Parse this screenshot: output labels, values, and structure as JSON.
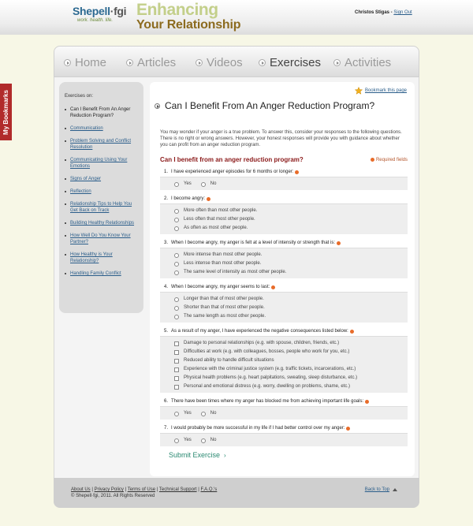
{
  "header": {
    "brand_a": "Shepell",
    "brand_b": "·fgi",
    "tagline": "work. health. life.",
    "program_line1": "Enhancing",
    "program_line2": "Your Relationship",
    "user": "Christos Stigas",
    "signout": "Sign Out",
    "separator": " - "
  },
  "bookmarks_tab": "My Bookmarks",
  "nav": {
    "tabs": [
      "Home",
      "Articles",
      "Videos",
      "Exercises",
      "Activities"
    ],
    "active": "Exercises"
  },
  "sidebar": {
    "heading": "Exercises on:",
    "items": [
      "Can I Benefit From An Anger Reduction Program?",
      "Communication",
      "Problem Solving and Conflict Resolution",
      "Communicating Using Your Emotions",
      "Signs of Anger",
      "Reflection",
      "Relationship Tips to Help You Get Back on Track",
      "Building Healthy Relationships",
      "How Well Do You Know Your Partner?",
      "How Healthy is Your Relationship?",
      "Handling Family Conflict"
    ]
  },
  "content": {
    "bookmark": "Bookmark this page",
    "title": "Can I Benefit From An Anger Reduction Program?",
    "intro": "You may wonder if your anger is a true problem. To answer this, consider your responses to the following questions. There is no right or wrong answers. However, your honest responses will provide you with guidance about whether you can profit from an anger reduction program.",
    "form_title": "Can I benefit from an anger reduction program?",
    "required": "Required fields",
    "submit": "Submit Exercise",
    "questions": [
      {
        "n": "1.",
        "text": "I have experienced anger episodes for 6 months or longer:",
        "type": "yn",
        "options": [
          "Yes",
          "No"
        ]
      },
      {
        "n": "2.",
        "text": "I become angry:",
        "type": "radio",
        "options": [
          "More often than most other people.",
          "Less often that most other people.",
          "As often as most other people."
        ]
      },
      {
        "n": "3.",
        "text": "When I become angry, my anger is felt at a level of intensity or strength that is:",
        "type": "radio",
        "options": [
          "More intense than most other people.",
          "Less intense than most other people.",
          "The same level of intensity as most other people."
        ]
      },
      {
        "n": "4.",
        "text": "When I become angry, my anger seems to last:",
        "type": "radio",
        "options": [
          "Longer than that of most other people.",
          "Shorter than that of most other people.",
          "The same length as most other people."
        ]
      },
      {
        "n": "5.",
        "text": "As a result of my anger, I have experienced the negative consequences listed below:",
        "type": "check",
        "options": [
          "Damage to personal relationships (e.g. with spouse, children, friends, etc.)",
          "Difficulties at work (e.g. with colleagues, bosses, people who work for you, etc.)",
          "Reduced ability to handle difficult situations",
          "Experience with the criminal justice system (e.g. traffic tickets, incarcerations, etc.)",
          "Physical health problems (e.g. heart palpitations, sweating, sleep disturbance, etc.)",
          "Personal and emotional distress (e.g. worry, dwelling on problems, shame, etc.)"
        ]
      },
      {
        "n": "6.",
        "text": "There have been times where my anger has blocked me from achieving important life goals:",
        "type": "yn",
        "options": [
          "Yes",
          "No"
        ]
      },
      {
        "n": "7.",
        "text": "I would probably be more successful in my life if I had better control over my anger:",
        "type": "yn",
        "options": [
          "Yes",
          "No"
        ]
      }
    ]
  },
  "footer": {
    "links": [
      "About Us",
      "Privacy Policy",
      "Terms of Use",
      "Technical Support",
      "F.A.Q.'s"
    ],
    "copyright": "© Shepell·fgi, 2011. All Rights Reserved",
    "back_to_top": "Back to Top"
  },
  "colors": {
    "accent": "#2b8a72",
    "required": "#e86c2a",
    "title_red": "#8b1a1a"
  }
}
